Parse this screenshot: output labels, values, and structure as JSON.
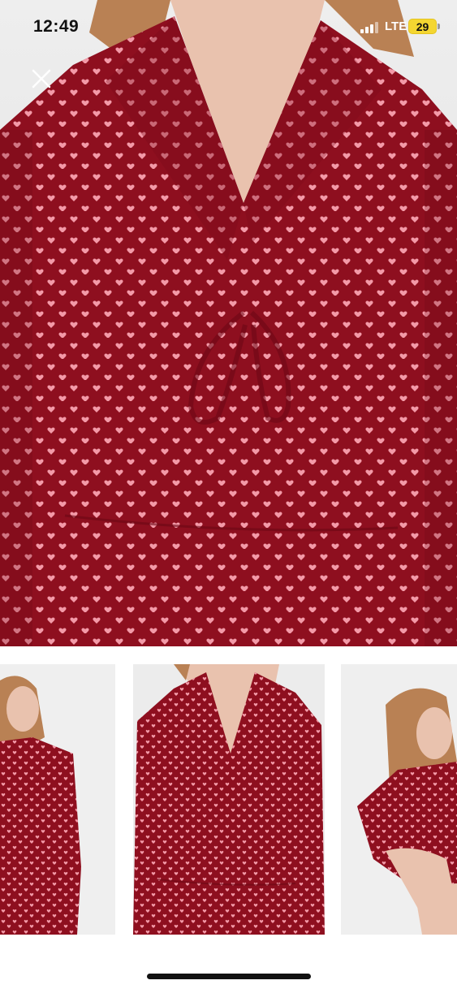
{
  "status_bar": {
    "time": "12:49",
    "network": "LTE",
    "battery_level": "29",
    "icons": [
      "signal-icon",
      "battery-icon",
      "charging-bolt-icon"
    ]
  },
  "gallery": {
    "close_icon": "close-icon",
    "selected_index": 1,
    "thumbnail_count": 3,
    "colors": {
      "fabric": "#8e0f1f",
      "heart": "#f39aa8",
      "skin": "#e9c2ae",
      "hair": "#b98154",
      "selected_outline": "#d9955a"
    }
  }
}
